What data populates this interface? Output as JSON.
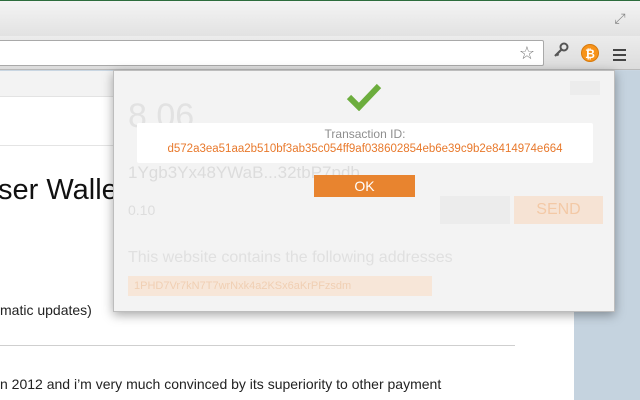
{
  "browser": {
    "toolbar_icons": {
      "expand": "expand-icon",
      "star": "star-icon",
      "extension_1": "key-icon",
      "extension_2": "bitcoin-icon",
      "menu": "menu-icon"
    },
    "bitcoin_symbol": "₿"
  },
  "page": {
    "heading": "ser Walle",
    "note": "matic updates)",
    "paragraph": "n 2012 and i’m very much convinced by its superiority to other payment"
  },
  "popup": {
    "background_balance": "8.06",
    "background_address": "1Ygb3Yx48YWaB...32tbP7pdb",
    "background_amount": "0.10",
    "background_send_label": "SEND",
    "background_website_text": "This website contains the following addresses",
    "background_address_chip": "1PHD7Vr7kN7T7wrNxk4a2KSx6aKrPFzsdm",
    "dialog": {
      "transaction_label": "Transaction ID:",
      "transaction_id": "d572a3ea51aa2b510bf3ab35c054ff9af038602854eb6e39c9b2e8414974e664",
      "ok_label": "OK",
      "success_icon": "checkmark-icon"
    }
  },
  "colors": {
    "accent": "#e8842f",
    "txn_id": "#e8792c",
    "checkmark": "#6cad3d"
  }
}
